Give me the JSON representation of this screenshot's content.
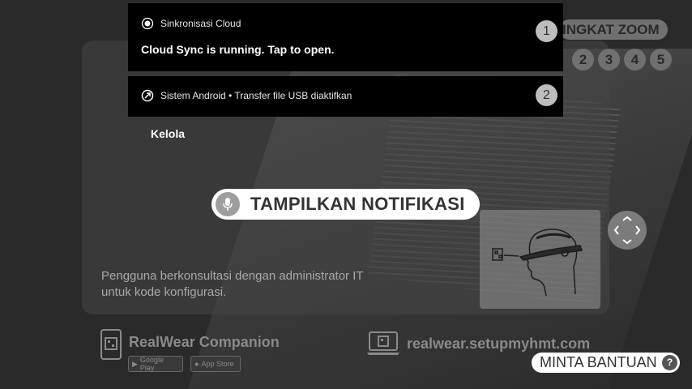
{
  "zoom": {
    "label": "INGKAT ZOOM",
    "levels": [
      "2",
      "3",
      "4",
      "5"
    ]
  },
  "notifications": [
    {
      "app": "Sinkronisasi Cloud",
      "message": "Cloud Sync is running. Tap to open.",
      "badge": "1",
      "icon": "cloud-sync-icon"
    },
    {
      "app": "Sistem Android • Transfer file USB diaktifkan",
      "badge": "2",
      "icon": "android-system-icon"
    }
  ],
  "manage_label": "Kelola",
  "voice_command": {
    "label": "TAMPILKAN NOTIFIKASI",
    "icon": "microphone-icon"
  },
  "hint_text": "Pengguna berkonsultasi dengan administrator IT untuk kode konfigurasi.",
  "companion": {
    "title": "RealWear Companion",
    "google_play": "Google Play",
    "app_store": "App Store"
  },
  "website": "realwear.setupmyhmt.com",
  "help": {
    "label": "MINTA BANTUAN",
    "icon_text": "?"
  }
}
